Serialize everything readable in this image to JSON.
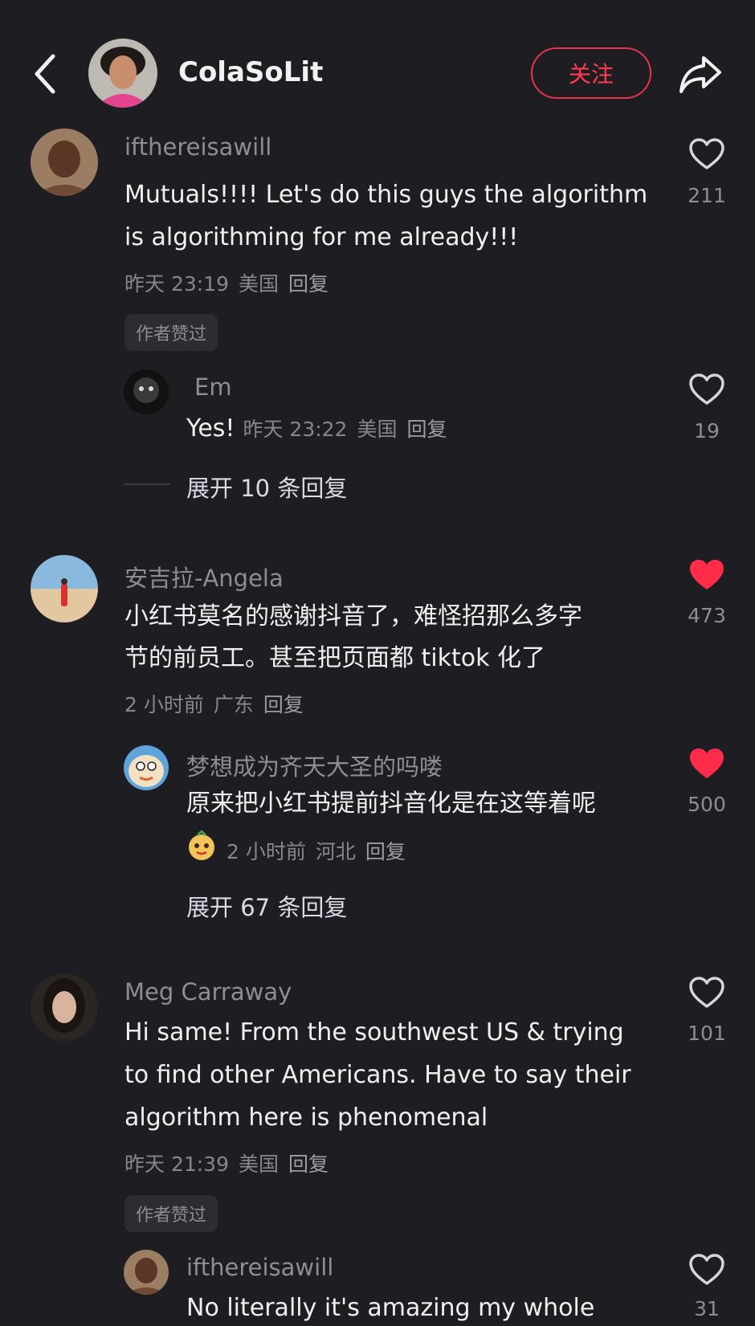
{
  "header": {
    "username": "ColaSoLit",
    "follow_label": "关注"
  },
  "comments": [
    {
      "username": "ifthereisawill",
      "lines": [
        "Mutuals!!!! Let's do this guys the algorithm",
        "is algorithming for me already!!!"
      ],
      "time": "昨天 23:19",
      "location": "美国",
      "reply_label": "回复",
      "badge": "作者赞过",
      "likes": "211",
      "liked": false,
      "sub_reply": {
        "username": "Em",
        "text": "Yes!",
        "time": "昨天 23:22",
        "location": "美国",
        "reply_label": "回复",
        "likes": "19",
        "liked": false
      },
      "expand_label": "展开 10 条回复"
    },
    {
      "username": "安吉拉-Angela",
      "lines": [
        "小红书莫名的感谢抖音了，难怪招那么多字",
        "节的前员工。甚至把页面都 tiktok 化了"
      ],
      "time": "2 小时前",
      "location": "广东",
      "reply_label": "回复",
      "likes": "473",
      "liked": true,
      "sub_reply": {
        "username": "梦想成为齐天大圣的吗喽",
        "text": "原来把小红书提前抖音化是在这等着呢",
        "time": "2 小时前",
        "location": "河北",
        "reply_label": "回复",
        "likes": "500",
        "liked": true
      },
      "expand_label": "展开 67 条回复"
    },
    {
      "username": "Meg Carraway",
      "lines": [
        "Hi same! From the southwest US & trying",
        "to find other Americans. Have to say their",
        "algorithm here is phenomenal"
      ],
      "time": "昨天 21:39",
      "location": "美国",
      "reply_label": "回复",
      "badge": "作者赞过",
      "likes": "101",
      "liked": false,
      "sub_reply": {
        "username": "ifthereisawill",
        "text": "No literally it's amazing my whole",
        "likes": "31",
        "liked": false
      }
    }
  ],
  "colors": {
    "background": "#1e1e22",
    "accent_red": "#ff3b54",
    "liked_heart": "#ff2c4a"
  }
}
